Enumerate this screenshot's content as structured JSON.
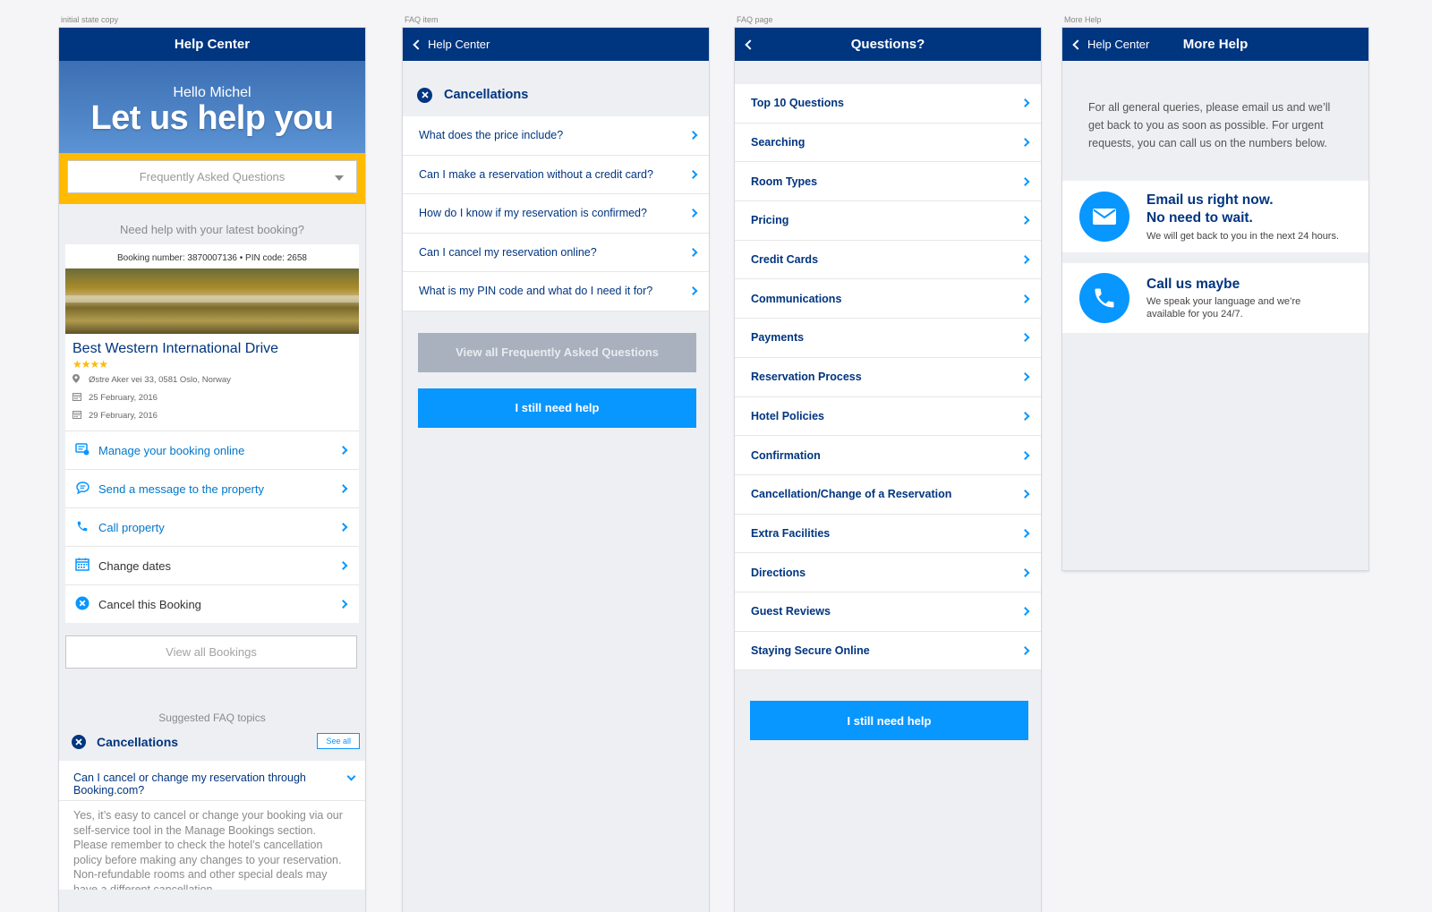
{
  "screen_labels": {
    "s1": "initial state copy",
    "s2": "FAQ item",
    "s3": "FAQ page",
    "s4": "More Help"
  },
  "screen1": {
    "nav_title": "Help Center",
    "hero_greeting": "Hello Michel",
    "hero_title": "Let us help you",
    "faq_select_value": "Frequently Asked Questions",
    "booking_prompt": "Need help with your latest booking?",
    "booking_number_line": "Booking number: 3870007136 • PIN code: 2658",
    "hotel_name": "Best Western International Drive",
    "hotel_stars": "★★★★",
    "address": "Østre Aker vei 33, 0581 Oslo, Norway",
    "checkin_date": "25 February, 2016",
    "checkout_date": "29 February, 2016",
    "actions": [
      {
        "label": "Manage your booking online"
      },
      {
        "label": "Send a message to the property"
      },
      {
        "label": "Call property"
      },
      {
        "label": "Change dates"
      },
      {
        "label": "Cancel this Booking"
      }
    ],
    "view_all_bookings": "View all Bookings",
    "suggested_heading": "Suggested FAQ topics",
    "topic_name": "Cancellations",
    "see_all": "See all",
    "faq_question": "Can I cancel or change my reservation through Booking.com?",
    "faq_answer": "Yes, it’s easy to cancel or change your booking via our self-service tool in the Manage Bookings section. Please remember to check the hotel’s cancellation policy before making any changes to your reservation. Non-refundable rooms and other special deals may have a different cancellation"
  },
  "screen2": {
    "back_label": "Help Center",
    "category": "Cancellations",
    "questions": [
      {
        "label": "What does the price include?"
      },
      {
        "label": "Can I make a reservation without a credit card?"
      },
      {
        "label": "How do I know if my reservation is confirmed?"
      },
      {
        "label": "Can I cancel my reservation online?"
      },
      {
        "label": "What is my PIN code and what do I need it for?"
      }
    ],
    "view_all_faq": "View all Frequently Asked Questions",
    "still_need_help": "I still need help"
  },
  "screen3": {
    "nav_title": "Questions?",
    "topics": [
      {
        "label": "Top 10 Questions"
      },
      {
        "label": "Searching"
      },
      {
        "label": "Room Types"
      },
      {
        "label": "Pricing"
      },
      {
        "label": "Credit Cards"
      },
      {
        "label": "Communications"
      },
      {
        "label": "Payments"
      },
      {
        "label": "Reservation Process"
      },
      {
        "label": "Hotel Policies"
      },
      {
        "label": "Confirmation"
      },
      {
        "label": "Cancellation/Change of a Reservation"
      },
      {
        "label": "Extra Facilities"
      },
      {
        "label": "Directions"
      },
      {
        "label": "Guest Reviews"
      },
      {
        "label": "Staying Secure Online"
      }
    ],
    "still_need_help": "I still need help"
  },
  "screen4": {
    "back_label": "Help Center",
    "nav_title": "More Help",
    "intro": "For all general queries, please email us and we’ll get back to you as soon as possible. For urgent requests, you can call us on the numbers below.",
    "email_title_1": "Email us right now.",
    "email_title_2": "No need to wait.",
    "email_sub": "We will get back to you in the next 24 hours.",
    "call_title": "Call us maybe",
    "call_sub_1": "We speak your language and we’re",
    "call_sub_2": "available for you 24/7."
  },
  "colors": {
    "nav_blue": "#003580",
    "accent_blue": "#0896ff",
    "yellow": "#febb02"
  }
}
